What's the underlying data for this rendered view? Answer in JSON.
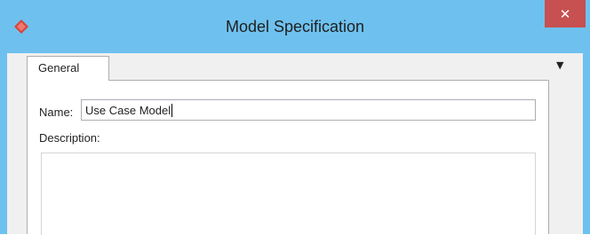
{
  "window": {
    "title": "Model Specification",
    "icons": {
      "app": "app-logo-icon",
      "close": "close-icon",
      "tab_menu": "dropdown-arrow-icon"
    },
    "colors": {
      "titlebar": "#6ec1ef",
      "close_button": "#c75050",
      "app_icon": "#d9433b"
    }
  },
  "tabs": [
    {
      "label": "General",
      "selected": true
    }
  ],
  "form": {
    "name_label": "Name:",
    "name_value": "Use Case Model",
    "description_label": "Description:",
    "description_value": ""
  }
}
